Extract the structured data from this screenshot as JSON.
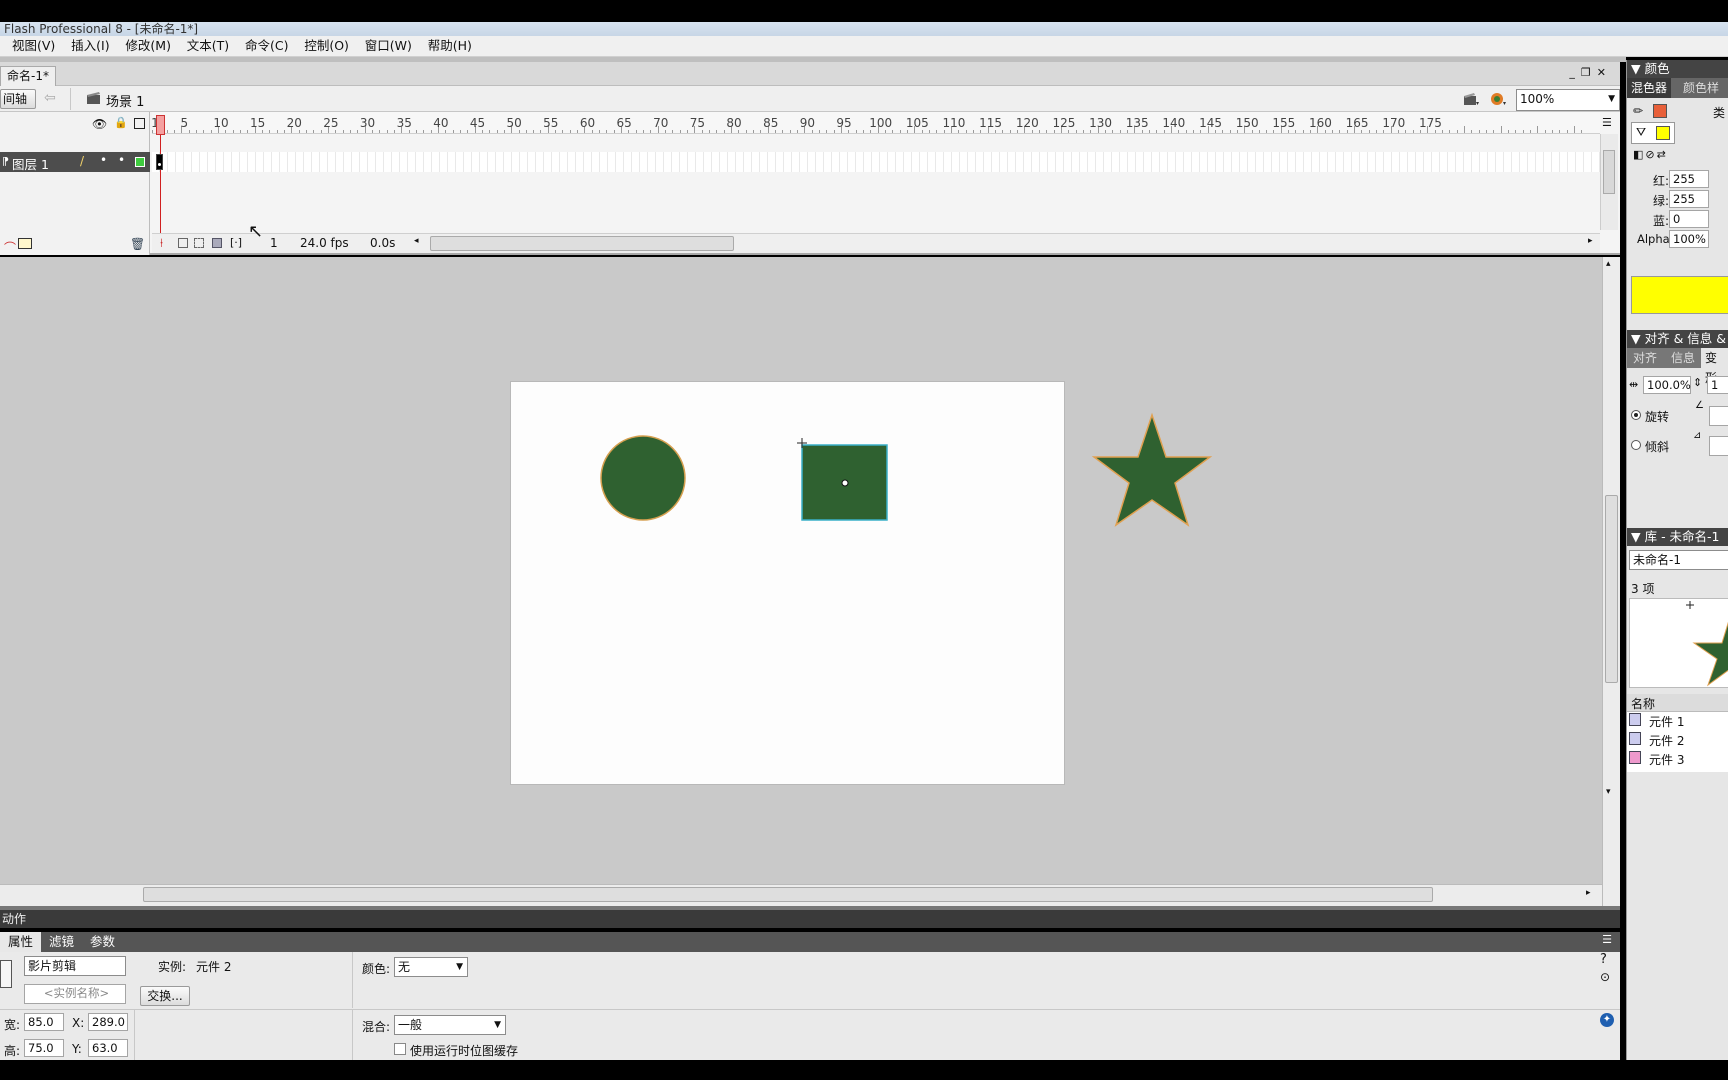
{
  "window": {
    "title": "Flash Professional 8 - [未命名-1*]"
  },
  "menu": [
    "视图(V)",
    "插入(I)",
    "修改(M)",
    "文本(T)",
    "命令(C)",
    "控制(O)",
    "窗口(W)",
    "帮助(H)"
  ],
  "document": {
    "tab_label": "命名-1*"
  },
  "scenebar": {
    "timeline_button": "间轴",
    "scene_label": "场景 1",
    "zoom": "100%"
  },
  "timeline": {
    "ruler_labels": [
      "1",
      "5",
      "10",
      "15",
      "20",
      "25",
      "30",
      "35",
      "40",
      "45",
      "50",
      "55",
      "60",
      "65",
      "70",
      "75",
      "80",
      "85",
      "90",
      "95",
      "100",
      "105",
      "110",
      "115",
      "120",
      "125",
      "130",
      "135",
      "140",
      "145",
      "150",
      "155",
      "160",
      "165",
      "170",
      "175"
    ],
    "layer_name": "图层 1",
    "current_frame": "1",
    "fps": "24.0 fps",
    "elapsed": "0.0s"
  },
  "stage": {
    "fill_color": "#2f6130",
    "stroke_color": "#e0a050",
    "selection_color": "#3ab0c8"
  },
  "actions_panel": {
    "label": "动作"
  },
  "properties": {
    "tabs": [
      "属性",
      "滤镜",
      "参数"
    ],
    "symbol_type": "影片剪辑",
    "instance_name_placeholder": "<实例名称>",
    "instance_label": "实例:",
    "instance_value": "元件 2",
    "swap_button": "交换...",
    "color_label": "颜色:",
    "color_value": "无",
    "blend_label": "混合:",
    "blend_value": "一般",
    "bitmap_cache_label": "使用运行时位图缓存",
    "width_label": "宽:",
    "width_value": "85.0",
    "height_label": "高:",
    "height_value": "75.0",
    "x_label": "X:",
    "x_value": "289.0",
    "y_label": "Y:",
    "y_value": "63.0"
  },
  "color_panel": {
    "title": "颜色",
    "tab_mixer": "混色器",
    "tab_swatches": "颜色样",
    "type_label": "类",
    "red_label": "红:",
    "red_value": "255",
    "green_label": "绿:",
    "green_value": "255",
    "blue_label": "蓝:",
    "blue_value": "0",
    "alpha_label": "Alpha:",
    "alpha_value": "100%",
    "stroke_color": "#e8603a",
    "fill_color": "#ffff00"
  },
  "align_panel": {
    "title": "对齐 & 信息 &",
    "tab_align": "对齐",
    "tab_info": "信息",
    "tab_transform": "变形",
    "scale_value": "100.0%",
    "scale_value2": "1",
    "rotate_label": "旋转",
    "skew_label": "倾斜"
  },
  "library_panel": {
    "title": "库 - 未命名-1",
    "doc_select": "未命名-1",
    "count": "3 项",
    "name_header": "名称",
    "items": [
      "元件 1",
      "元件 2",
      "元件 3"
    ]
  }
}
